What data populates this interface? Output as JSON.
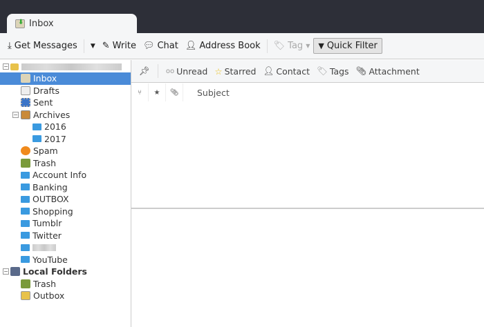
{
  "tab": {
    "title": "Inbox"
  },
  "toolbar": {
    "get_messages": "Get Messages",
    "write": "Write",
    "chat": "Chat",
    "address_book": "Address Book",
    "tag": "Tag",
    "quick_filter": "Quick Filter"
  },
  "folders": {
    "inbox": "Inbox",
    "drafts": "Drafts",
    "sent": "Sent",
    "archives": "Archives",
    "y2016": "2016",
    "y2017": "2017",
    "spam": "Spam",
    "trash": "Trash",
    "account_info": "Account Info",
    "banking": "Banking",
    "outbox_folder": "OUTBOX",
    "shopping": "Shopping",
    "tumblr": "Tumblr",
    "twitter": "Twitter",
    "youtube": "YouTube",
    "local_folders": "Local Folders",
    "local_trash": "Trash",
    "local_outbox": "Outbox"
  },
  "filter": {
    "unread": "Unread",
    "starred": "Starred",
    "contact": "Contact",
    "tags": "Tags",
    "attachment": "Attachment"
  },
  "columns": {
    "subject": "Subject"
  },
  "colors": {
    "selection": "#4a8bd8",
    "titlebar": "#2d2f38",
    "folder": "#3a9ae0"
  }
}
